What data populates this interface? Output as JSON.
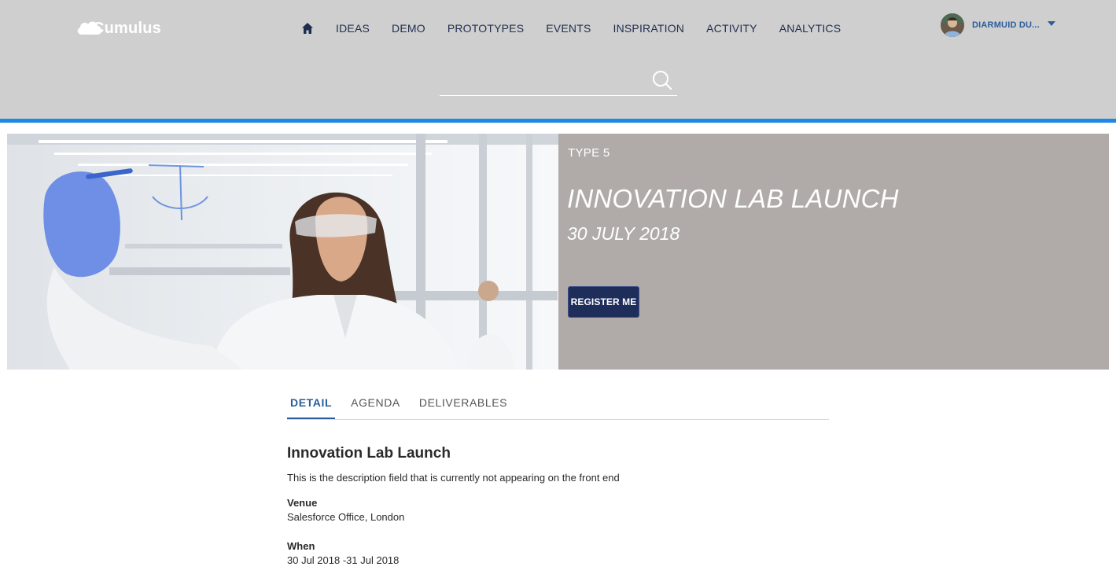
{
  "header": {
    "logo_text": "Cumulus",
    "nav": [
      {
        "label": "IDEAS"
      },
      {
        "label": "DEMO"
      },
      {
        "label": "PROTOTYPES"
      },
      {
        "label": "EVENTS"
      },
      {
        "label": "INSPIRATION"
      },
      {
        "label": "ACTIVITY"
      },
      {
        "label": "ANALYTICS"
      }
    ],
    "user_name": "DIARMUID DU...",
    "search_placeholder": "",
    "accent_color": "#1b8ae6"
  },
  "hero": {
    "type": "TYPE 5",
    "title": "INNOVATION LAB LAUNCH",
    "date": "30 JULY 2018",
    "register_label": "REGISTER ME"
  },
  "tabs": [
    {
      "label": "DETAIL",
      "active": true
    },
    {
      "label": "AGENDA",
      "active": false
    },
    {
      "label": "DELIVERABLES",
      "active": false
    }
  ],
  "detail": {
    "title": "Innovation Lab Launch",
    "description": "This is the description field that is currently not appearing on the front end",
    "venue_label": "Venue",
    "venue_value": "Salesforce Office, London",
    "when_label": "When",
    "when_value": "30 Jul 2018 -31 Jul 2018"
  }
}
